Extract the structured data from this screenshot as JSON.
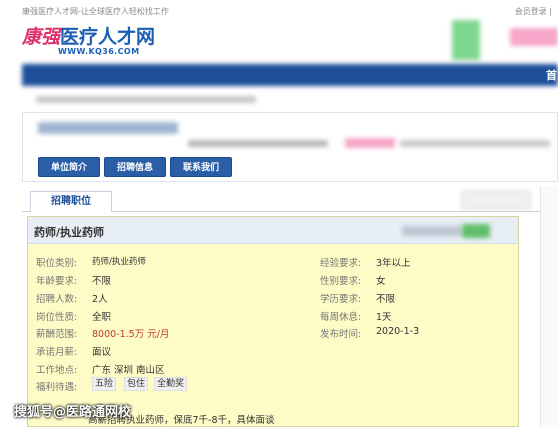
{
  "header": {
    "tagline": "康强医疗人才网-让全球医疗人轻松找工作",
    "login_link": "会员登录 |",
    "logo_name_part1": "康强",
    "logo_name_part2": "医疗人才网",
    "logo_url": "WWW.KQ36.COM",
    "nav_right": "首"
  },
  "company": {
    "buttons": {
      "intro": "单位简介",
      "jobs": "招聘信息",
      "contact": "联系我们"
    }
  },
  "tabs": {
    "recruit": "招聘职位"
  },
  "job": {
    "title": "药师/执业药师",
    "left": [
      {
        "label": "职位类别:",
        "value": "药师/执业药师"
      },
      {
        "label": "年龄要求:",
        "value": "不限"
      },
      {
        "label": "招聘人数:",
        "value": "2人"
      },
      {
        "label": "岗位性质:",
        "value": "全职"
      },
      {
        "label": "薪酬范围:",
        "value": "8000-1.5万 元/月"
      },
      {
        "label": "承诺月薪:",
        "value": "面议"
      },
      {
        "label": "工作地点:",
        "value": "广东 深圳 南山区"
      },
      {
        "label": "福利待遇:",
        "value": ""
      }
    ],
    "right": [
      {
        "label": "经验要求:",
        "value": "3年以上"
      },
      {
        "label": "性别要求:",
        "value": "女"
      },
      {
        "label": "学历要求:",
        "value": "不限"
      },
      {
        "label": "每周休息:",
        "value": "1天"
      },
      {
        "label": "发布时间:",
        "value": "2020-1-3"
      }
    ],
    "benefits": [
      "五险",
      "包住",
      "全勤奖"
    ],
    "notes": "高薪招聘执业药师，保底7千-8千，具体面谈"
  },
  "watermark": "搜狐号@医路通网校",
  "colors": {
    "nav": "#1d4f9a",
    "button": "#2a5fa8",
    "panel": "#fdfbc6",
    "salary": "#c0392b"
  }
}
